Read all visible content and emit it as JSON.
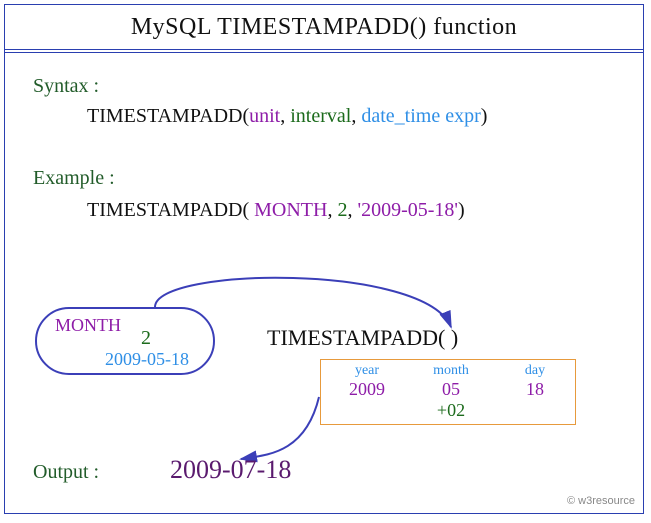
{
  "title": "MySQL  TIMESTAMPADD() function",
  "syntax": {
    "label": "Syntax :",
    "fn": "TIMESTAMPADD(",
    "unit": "unit",
    "sep1": ", ",
    "interval": "interval",
    "sep2": ", ",
    "datetime": "date_time expr",
    "close": ")"
  },
  "example": {
    "label": "Example :",
    "fn": "TIMESTAMPADD( ",
    "unit": "MONTH",
    "sep1": ", ",
    "interval": "2",
    "sep2": ", ",
    "date": "'2009-05-18'",
    "close": ")"
  },
  "inputs": {
    "unit": "MONTH",
    "interval": "2",
    "date": "2009-05-18"
  },
  "func_call": "TIMESTAMPADD(   )",
  "breakdown": {
    "year": {
      "label": "year",
      "value": "2009"
    },
    "month": {
      "label": "month",
      "value": "05",
      "delta": "+02"
    },
    "day": {
      "label": "day",
      "value": "18"
    }
  },
  "output": {
    "label": "Output :",
    "value": "2009-07-18"
  },
  "credit": "© w3resource"
}
